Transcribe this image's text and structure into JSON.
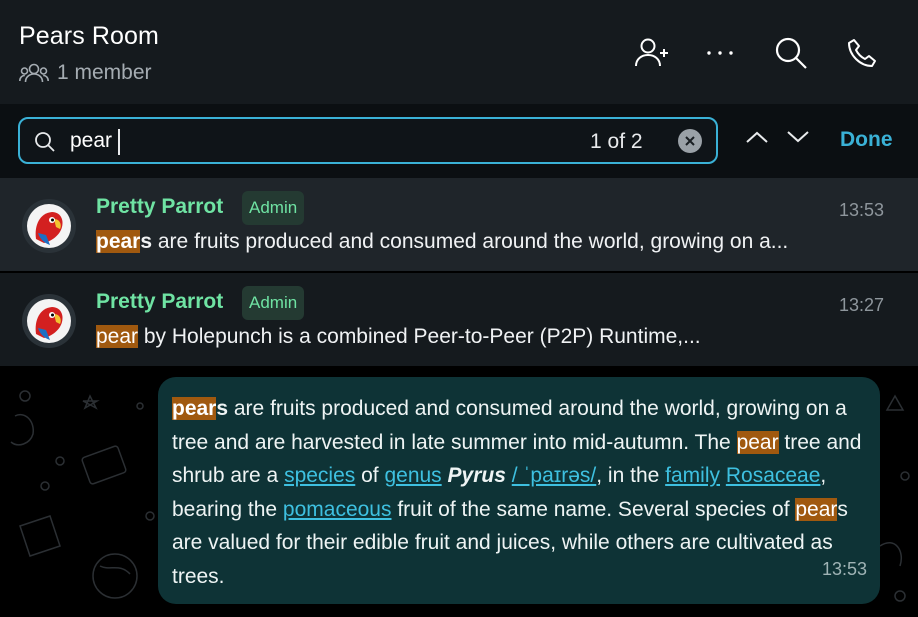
{
  "header": {
    "title": "Pears Room",
    "members_label": "1 member"
  },
  "search": {
    "query": "pear",
    "match_count": "1 of 2",
    "done_label": "Done"
  },
  "results": [
    {
      "sender": "Pretty Parrot",
      "badge": "Admin",
      "time": "13:53",
      "highlight": "pear",
      "highlight_suffix": "s",
      "rest": " are fruits produced and consumed around the world, growing on a..."
    },
    {
      "sender": "Pretty Parrot",
      "badge": "Admin",
      "time": "13:27",
      "highlight": "pear",
      "rest": " by Holepunch is a combined Peer-to-Peer (P2P) Runtime,..."
    }
  ],
  "message": {
    "hl1": "pear",
    "hl1_suffix": "s",
    "t1": " are fruits produced and consumed around the world, growing on a tree and are harvested in late summer into mid-autumn. The ",
    "hl2": "pear",
    "t2": " tree and shrub are a ",
    "link_species": "species",
    "t3": " of ",
    "link_genus": "genus",
    "pyrus": "Pyrus",
    "link_ipa": "/ ˈpaɪrəs/",
    "t4": ", in the ",
    "link_family": "family",
    "link_rosaceae": "Rosaceae",
    "t5": ", bearing the ",
    "link_pomaceous": "pomaceous",
    "t6": " fruit of the same name. Several species of ",
    "hl3": "pear",
    "t7": "s are valued for their edible fruit and juices, while others are cultivated as trees.",
    "time": "13:53"
  },
  "colors": {
    "accent": "#3ab1d6",
    "sender": "#6fe3a3",
    "highlight": "#a0590f",
    "bubble": "#0e3336"
  }
}
